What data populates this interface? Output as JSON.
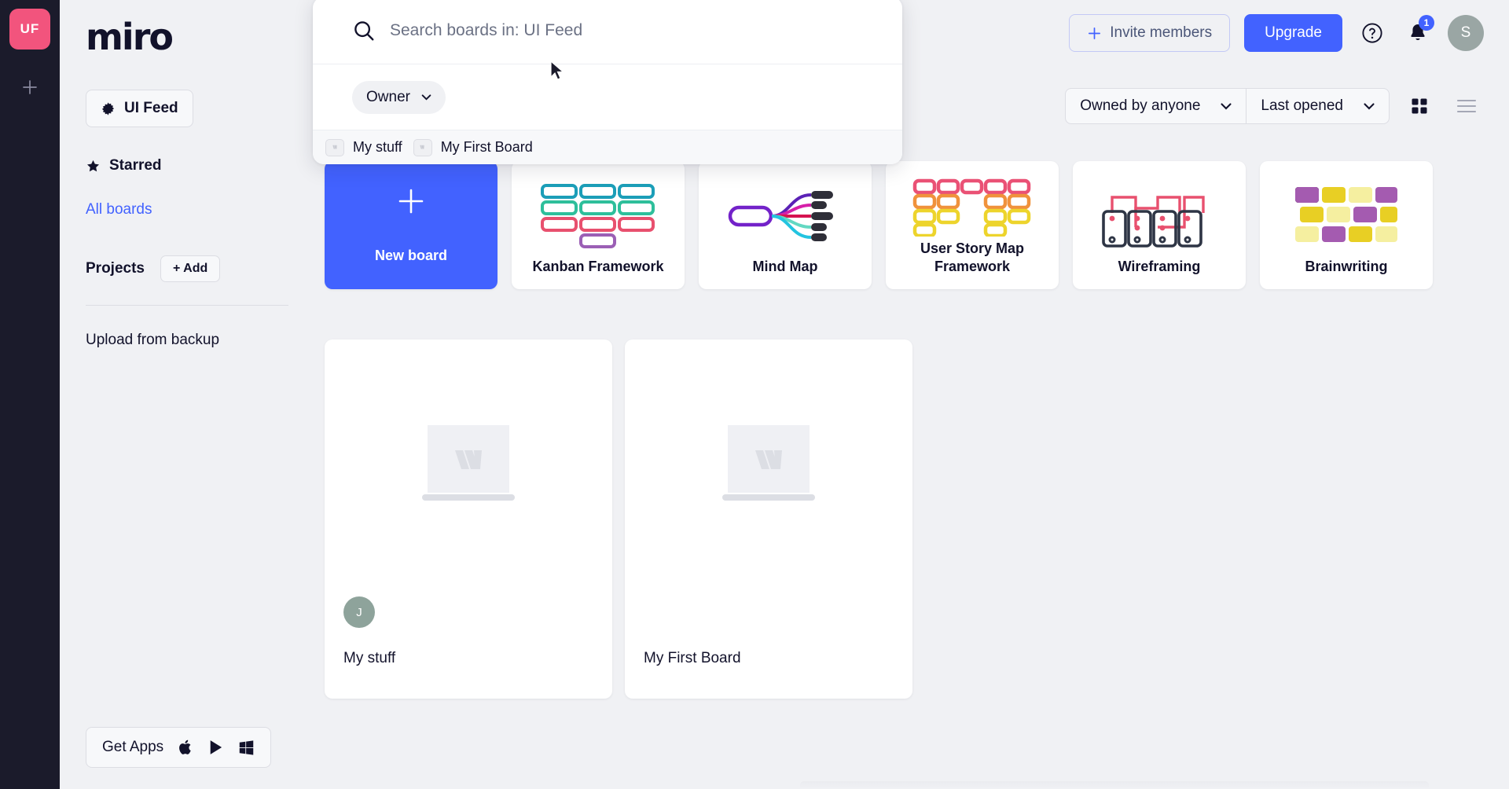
{
  "rail": {
    "team_badge": "UF",
    "add_team_icon": "plus-icon"
  },
  "sidebar": {
    "brand": "miro",
    "team_chip": {
      "label": "UI Feed",
      "icon": "gear-icon"
    },
    "starred": {
      "label": "Starred",
      "icon": "star-icon"
    },
    "all_boards": {
      "label": "All boards"
    },
    "projects": {
      "label": "Projects",
      "add_label": "+ Add"
    },
    "upload": {
      "label": "Upload from backup"
    },
    "get_apps": {
      "label": "Get Apps",
      "icons": [
        "apple-icon",
        "google-play-icon",
        "windows-icon"
      ]
    }
  },
  "header": {
    "invite_label": "Invite members",
    "invite_icon": "plus-icon",
    "upgrade_label": "Upgrade",
    "help_icon": "question-circle-icon",
    "notifications_icon": "bell-icon",
    "notifications_count": "1",
    "avatar_initial": "S"
  },
  "filterbar": {
    "owner_filter": "Owned by anyone",
    "sort_filter": "Last opened",
    "grid_view_icon": "grid-view-icon",
    "list_view_icon": "list-view-icon",
    "chevron_icon": "chevron-down-icon"
  },
  "search": {
    "placeholder": "Search boards in: UI Feed",
    "value": "",
    "search_icon": "search-icon",
    "owner_chip": {
      "label": "Owner",
      "icon": "chevron-down-icon"
    },
    "suggestions": [
      {
        "label": "My stuff"
      },
      {
        "label": "My First Board"
      }
    ]
  },
  "templates": [
    {
      "title": "New board",
      "kind": "new",
      "icon": "plus-icon"
    },
    {
      "title": "Kanban Framework",
      "kind": "kanban"
    },
    {
      "title": "Mind Map",
      "kind": "mindmap"
    },
    {
      "title": "User Story Map Framework",
      "kind": "userstory"
    },
    {
      "title": "Wireframing",
      "kind": "wireframe"
    },
    {
      "title": "Brainwriting",
      "kind": "brainwriting"
    }
  ],
  "boards": [
    {
      "name": "My stuff",
      "avatar_initial": "J",
      "has_avatar": true
    },
    {
      "name": "My First Board",
      "avatar_initial": "",
      "has_avatar": false
    }
  ],
  "colors": {
    "accent": "#4262ff",
    "rail_bg": "#1b1b2b",
    "team_badge": "#f2547d",
    "page_bg": "#f0f1f4",
    "text": "#12122b"
  }
}
